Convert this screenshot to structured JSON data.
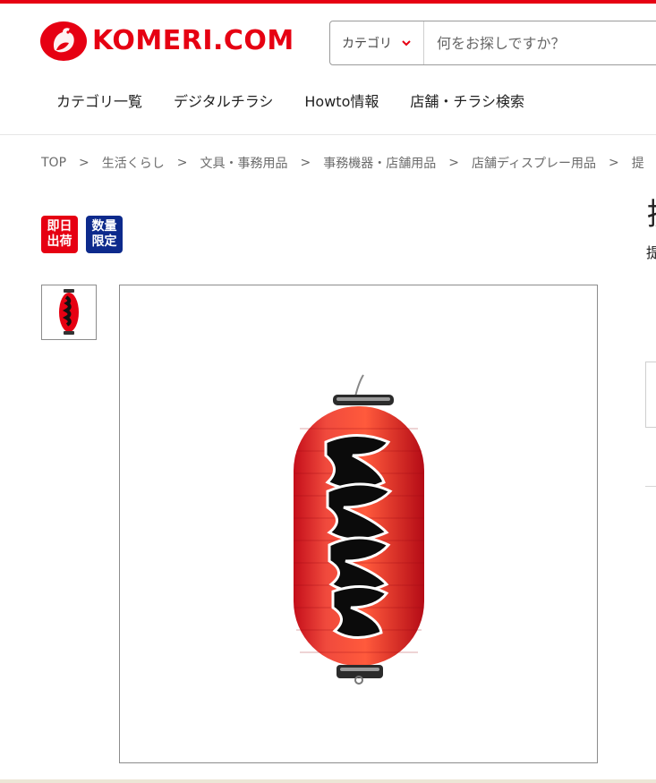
{
  "header": {
    "logo_text": "KOMERI.COM",
    "search": {
      "category_label": "カテゴリ",
      "placeholder": "何をお探しですか？"
    },
    "nav": [
      {
        "label": "カテゴリ一覧"
      },
      {
        "label": "デジタルチラシ"
      },
      {
        "label": "Howto情報"
      },
      {
        "label": "店舗・チラシ検索"
      }
    ]
  },
  "breadcrumb": [
    {
      "label": "TOP"
    },
    {
      "label": "生活くらし"
    },
    {
      "label": "文具・事務用品"
    },
    {
      "label": "事務機器・店舗用品"
    },
    {
      "label": "店舗ディスプレー用品"
    },
    {
      "label": "提"
    }
  ],
  "badges": [
    {
      "line1": "即日",
      "line2": "出荷",
      "color": "#e60012"
    },
    {
      "line1": "数量",
      "line2": "限定",
      "color": "#0d2a8c"
    }
  ],
  "product": {
    "title_partial": "提",
    "subtitle_partial": "提"
  },
  "colors": {
    "brand": "#e60012",
    "badge_blue": "#0d2a8c"
  },
  "icons": {
    "chevron": "chevron-down-icon",
    "logo": "rooster-logo-icon",
    "image": "red-lantern-image"
  }
}
